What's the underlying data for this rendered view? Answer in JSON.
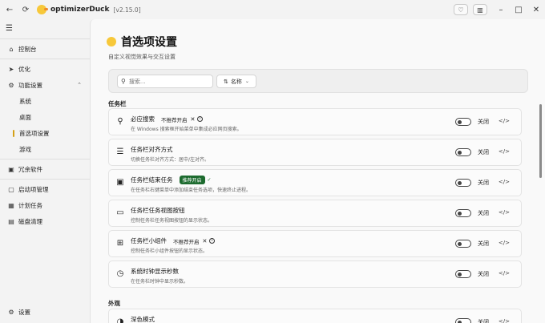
{
  "titlebar": {
    "app_name": "optimizerDuck",
    "version": "[v2.15.0]"
  },
  "sidebar": {
    "items": [
      {
        "label": "控制台",
        "icon": "home-icon"
      },
      {
        "label": "优化",
        "icon": "rocket-icon"
      },
      {
        "label": "功能设置",
        "icon": "gear-icon"
      }
    ],
    "sub_items": [
      {
        "label": "系统"
      },
      {
        "label": "桌面"
      },
      {
        "label": "首选项设置"
      },
      {
        "label": "游戏"
      }
    ],
    "items2": [
      {
        "label": "冗余软件",
        "icon": "box-icon"
      }
    ],
    "items3": [
      {
        "label": "启动项管理",
        "icon": "startup-icon"
      },
      {
        "label": "计划任务",
        "icon": "calendar-icon"
      },
      {
        "label": "磁盘清理",
        "icon": "disk-icon"
      }
    ],
    "settings_label": "设置"
  },
  "page": {
    "title": "首选项设置",
    "subtitle": "自定义视觉效果与交互设置"
  },
  "toolbar": {
    "search_placeholder": "搜索...",
    "sort_label": "名称"
  },
  "sections": {
    "taskbar": "任务栏",
    "appearance": "外观"
  },
  "cards": [
    {
      "title": "必应搜索",
      "desc": "在 Windows 搜索框开始菜单中集成必应网页搜索。",
      "badge_not": "不推荐开启",
      "toggle": "关闭"
    },
    {
      "title": "任务栏对齐方式",
      "desc": "切换任务栏对齐方式：居中/左对齐。",
      "toggle": "关闭"
    },
    {
      "title": "任务栏结束任务",
      "desc": "在任务栏右键菜单中添加结束任务选项，快速终止进程。",
      "badge_rec": "推荐开启",
      "toggle": "关闭"
    },
    {
      "title": "任务栏任务视图按钮",
      "desc": "控制任务栏任务视图按钮的显示状态。",
      "toggle": "关闭"
    },
    {
      "title": "任务栏小组件",
      "desc": "控制任务栏小组件按钮的显示状态。",
      "badge_not": "不推荐开启",
      "toggle": "关闭"
    },
    {
      "title": "系统时钟显示秒数",
      "desc": "在任务栏时钟中显示秒数。",
      "toggle": "关闭"
    },
    {
      "title": "深色模式",
      "desc": "",
      "toggle": "关闭"
    }
  ]
}
